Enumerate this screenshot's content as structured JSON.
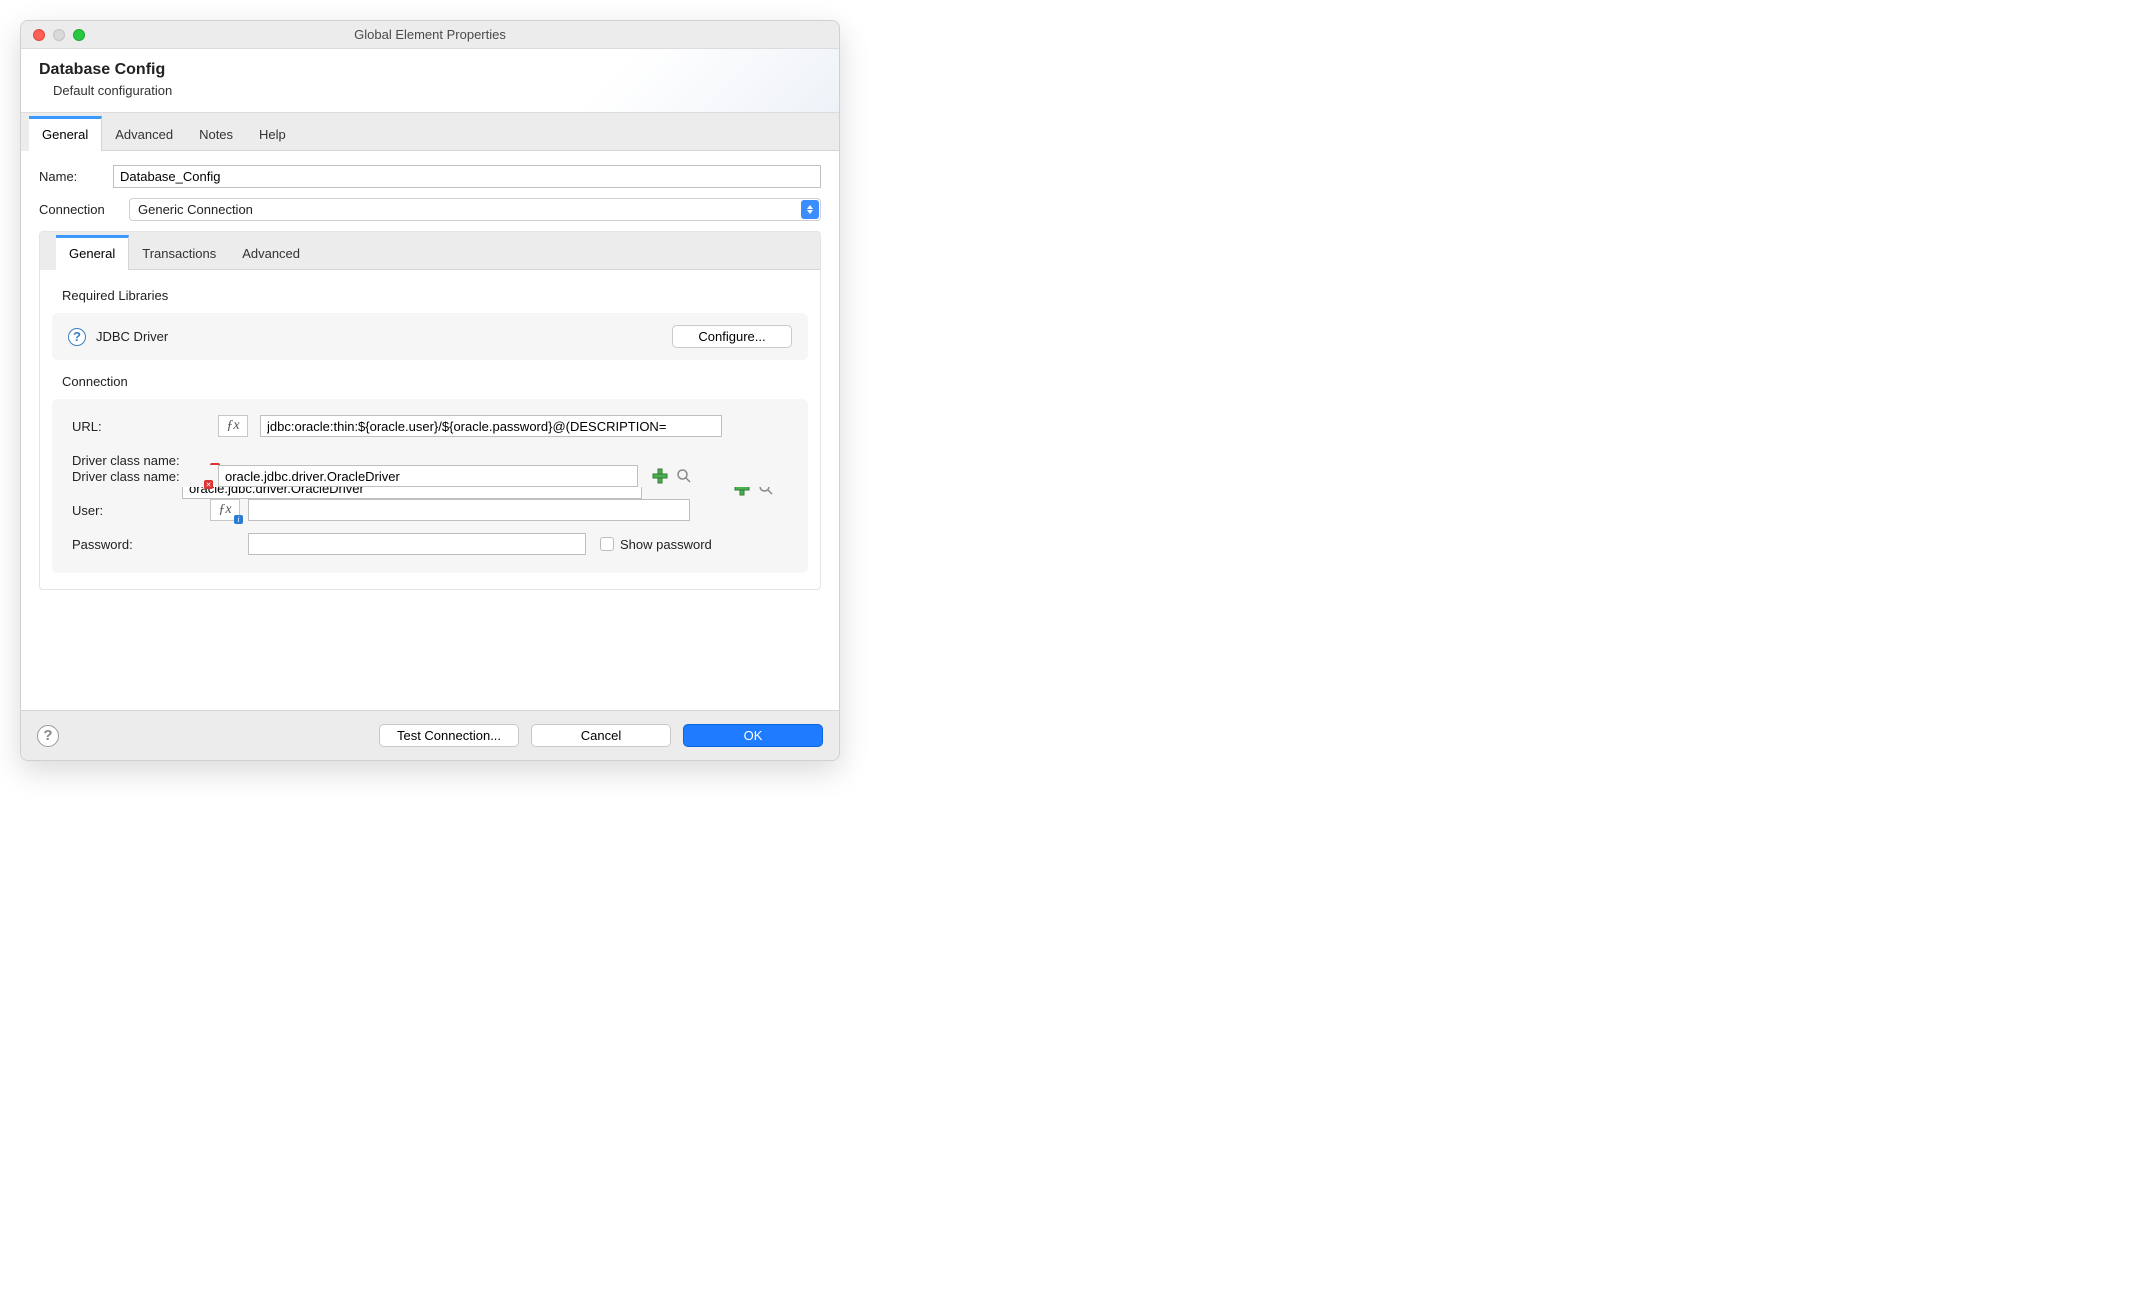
{
  "window_title": "Global Element Properties",
  "header": {
    "title": "Database Config",
    "subtitle": "Default configuration"
  },
  "tabs": {
    "outer": [
      "General",
      "Advanced",
      "Notes",
      "Help"
    ],
    "active_outer": 0,
    "inner": [
      "General",
      "Transactions",
      "Advanced"
    ],
    "active_inner": 0
  },
  "fields": {
    "name_label": "Name:",
    "name_value": "Database_Config",
    "connection_label": "Connection",
    "connection_value": "Generic Connection"
  },
  "required_libs": {
    "section_title": "Required Libraries",
    "driver_label": "JDBC Driver",
    "configure_label": "Configure..."
  },
  "connection": {
    "section_title": "Connection",
    "url_label": "URL:",
    "url_value": "jdbc:oracle:thin:${oracle.user}/${oracle.password}@(DESCRIPTION=",
    "driver_label": "Driver class name:",
    "driver_value": "oracle.jdbc.driver.OracleDriver",
    "user_label": "User:",
    "user_value": "",
    "password_label": "Password:",
    "password_value": "",
    "show_password_label": "Show password"
  },
  "footer": {
    "test_label": "Test Connection...",
    "cancel_label": "Cancel",
    "ok_label": "OK"
  }
}
